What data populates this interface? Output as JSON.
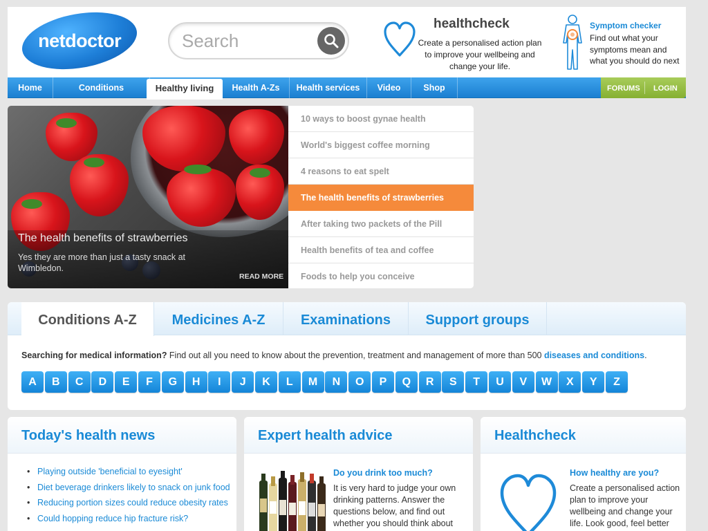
{
  "brand": {
    "logo_text": "netdoctor"
  },
  "search": {
    "placeholder": "Search"
  },
  "healthcheck_promo": {
    "title": "healthcheck",
    "text": "Create a personalised action plan to improve your wellbeing and change your life."
  },
  "symptom_checker": {
    "title": "Symptom checker",
    "text": "Find out what your symptoms mean and what you should do next"
  },
  "nav": {
    "items": [
      {
        "label": "Home"
      },
      {
        "label": "Conditions"
      },
      {
        "label": "Healthy living",
        "active": true
      },
      {
        "label": "Health A-Zs"
      },
      {
        "label": "Health services"
      },
      {
        "label": "Video"
      },
      {
        "label": "Shop"
      }
    ],
    "forums": "FORUMS",
    "login": "LOGIN"
  },
  "hero": {
    "title": "The health benefits of strawberries",
    "subtitle": "Yes they are more than just a tasty snack at Wimbledon.",
    "read_more": "READ MORE",
    "list": [
      "10 ways to boost gynae health",
      "World's biggest coffee morning",
      "4 reasons to eat spelt",
      "The health benefits of strawberries",
      "After taking two packets of the Pill",
      "Health benefits of tea and coffee",
      "Foods to help you conceive"
    ],
    "active_index": 3
  },
  "az": {
    "tabs": [
      "Conditions A-Z",
      "Medicines A-Z",
      "Examinations",
      "Support groups"
    ],
    "intro_bold": "Searching for medical information?",
    "intro_text": " Find out all you need to know about the prevention, treatment and management of more than 500 ",
    "intro_link": "diseases and conditions",
    "intro_end": ".",
    "letters": [
      "A",
      "B",
      "C",
      "D",
      "E",
      "F",
      "G",
      "H",
      "I",
      "J",
      "K",
      "L",
      "M",
      "N",
      "O",
      "P",
      "Q",
      "R",
      "S",
      "T",
      "U",
      "V",
      "W",
      "X",
      "Y",
      "Z"
    ]
  },
  "news": {
    "title": "Today's health news",
    "items": [
      "Playing outside 'beneficial to eyesight'",
      "Diet beverage drinkers likely to snack on junk food",
      "Reducing portion sizes could reduce obesity rates",
      "Could hopping reduce hip fracture risk?"
    ]
  },
  "advice": {
    "title": "Expert health advice",
    "sub": "Do you drink too much?",
    "body": "It is very hard to judge your own drinking patterns. Answer the questions below, and find out whether you should think about"
  },
  "healthcheck_card": {
    "title": "Healthcheck",
    "sub": "How healthy are you?",
    "body": "Create a personalised action plan to improve your wellbeing and change your life. Look good, feel better"
  },
  "colors": {
    "accent_blue": "#1a8ad6",
    "nav_blue": "#2a90e0",
    "orange_active": "#f58a3b",
    "forums_green": "#96bf45"
  }
}
